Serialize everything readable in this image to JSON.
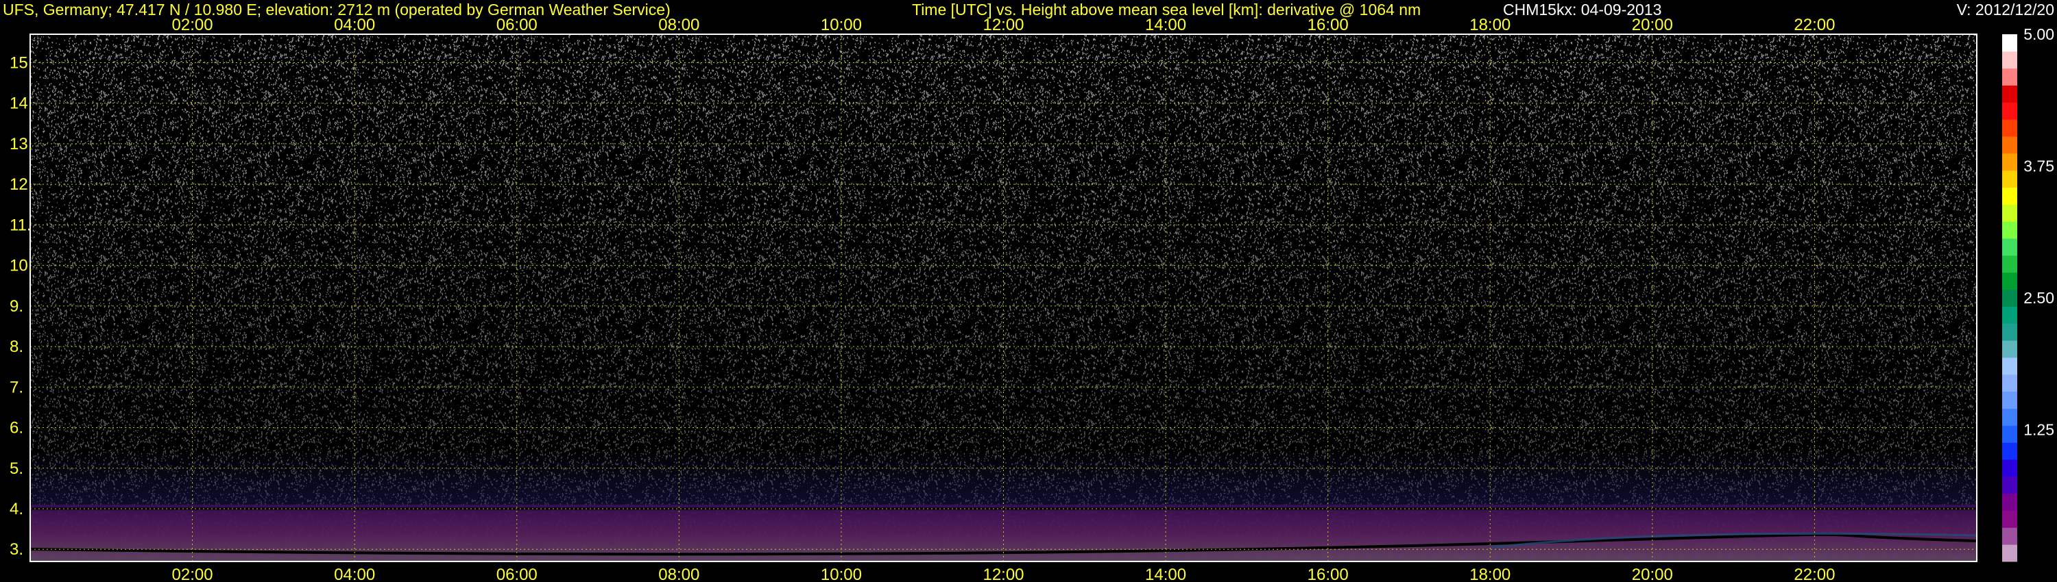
{
  "header": {
    "station": "UFS, Germany; 47.417 N / 10.980 E; elevation: 2712 m  (operated by German Weather Service)",
    "description": "Time [UTC] vs. Height above mean sea level [km]: derivative @ 1064 nm",
    "instrument_date": "CHM15kx: 04-09-2013",
    "version": "V: 2012/12/20"
  },
  "colors": {
    "background": "#000000",
    "axis_text": "#ffff33",
    "grid": "#c8c800",
    "plot_frame": "#ffffff"
  },
  "chart_data": {
    "type": "heatmap",
    "xlabel": "Time [UTC]",
    "ylabel": "Height above mean sea level [km]",
    "x_ticks": [
      "02:00",
      "04:00",
      "06:00",
      "08:00",
      "10:00",
      "12:00",
      "14:00",
      "16:00",
      "18:00",
      "20:00",
      "22:00"
    ],
    "x_tick_hours": [
      2,
      4,
      6,
      8,
      10,
      12,
      14,
      16,
      18,
      20,
      22
    ],
    "xlim_hours": [
      0,
      24
    ],
    "y_ticks": [
      "3.",
      "4.",
      "5.",
      "6.",
      "7.",
      "8.",
      "9.",
      "10.",
      "11.",
      "12.",
      "13.",
      "14.",
      "15."
    ],
    "y_tick_values": [
      3,
      4,
      5,
      6,
      7,
      8,
      9,
      10,
      11,
      12,
      13,
      14,
      15
    ],
    "ylim_km": [
      2.7,
      15.7
    ],
    "grid": true,
    "colorbar": {
      "ticks": [
        "5.00",
        "3.75",
        "2.50",
        "1.25"
      ],
      "tick_values": [
        5.0,
        3.75,
        2.5,
        1.25
      ],
      "range": [
        0,
        5
      ],
      "colors": [
        "#c8a0c8",
        "#a050a0",
        "#8a0a8a",
        "#7a0090",
        "#4a00c0",
        "#2a00e0",
        "#1030ff",
        "#2060ff",
        "#4080ff",
        "#6a9cff",
        "#8ab0ff",
        "#a0c8ff",
        "#60b4c0",
        "#20a090",
        "#00a078",
        "#008c50",
        "#00a030",
        "#20c040",
        "#40e060",
        "#80ff40",
        "#c8ff20",
        "#ffff00",
        "#ffd000",
        "#ffa000",
        "#ff7000",
        "#ff4000",
        "#ff1010",
        "#e00000",
        "#ff8080",
        "#ffc8c8",
        "#ffffff"
      ]
    },
    "features": {
      "noise_above_km": 5.5,
      "aerosol_layer_top_km": 4.1,
      "layer_line_km": 4.0
    }
  }
}
